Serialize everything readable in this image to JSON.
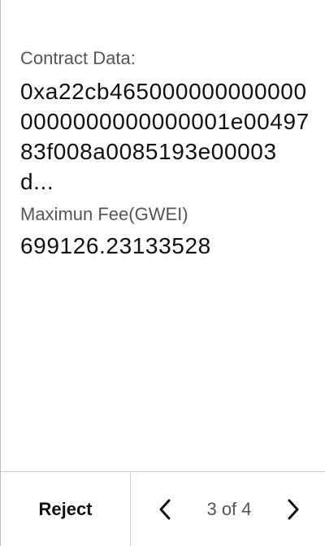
{
  "contract": {
    "label": "Contract Data:",
    "value": "0xa22cb4650000000000000000000000000001e0049783f008a0085193e00003d..."
  },
  "fee": {
    "label": "Maximun Fee(GWEI)",
    "value": "699126.23133528"
  },
  "footer": {
    "reject_label": "Reject",
    "page_indicator": "3 of 4",
    "prev_icon": "chevron-left-icon",
    "next_icon": "chevron-right-icon"
  }
}
